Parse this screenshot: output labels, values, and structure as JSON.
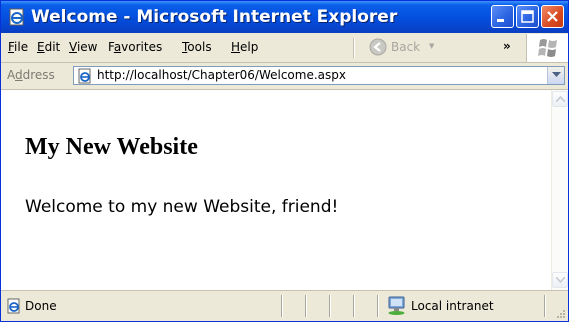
{
  "window": {
    "title": "Welcome - Microsoft Internet Explorer"
  },
  "menu": {
    "items": [
      {
        "accel": "F",
        "rest": "ile"
      },
      {
        "accel": "E",
        "rest": "dit"
      },
      {
        "accel": "V",
        "rest": "iew"
      },
      {
        "pre": "F",
        "accel": "a",
        "rest": "vorites"
      },
      {
        "accel": "T",
        "rest": "ools"
      },
      {
        "accel": "H",
        "rest": "elp"
      }
    ],
    "back_label": "Back",
    "chevron": "»"
  },
  "address": {
    "label_pre": "A",
    "label_accel": "d",
    "label_rest": "dress",
    "url": "http://localhost/Chapter06/Welcome.aspx"
  },
  "page": {
    "heading": "My New Website",
    "text": "Welcome to my new Website, friend!"
  },
  "status": {
    "text": "Done",
    "zone": "Local intranet"
  },
  "colors": {
    "titlebar": "#0554e3",
    "close_button": "#d84a21",
    "chrome": "#ece9d8"
  },
  "icons": {
    "app": "ie-page-icon",
    "back": "back-arrow-icon",
    "flag": "windows-flag-icon",
    "zone": "local-intranet-icon"
  }
}
